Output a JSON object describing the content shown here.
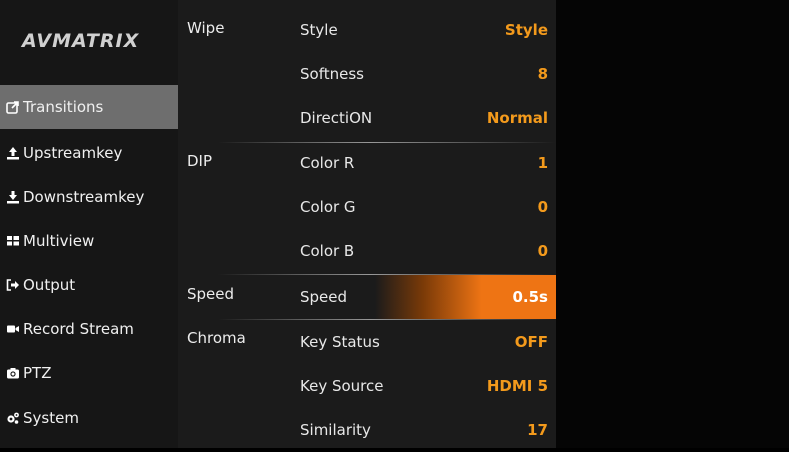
{
  "brand": {
    "logo_text": "AVMATRIX"
  },
  "sidebar": {
    "items": [
      {
        "label": "Transitions",
        "icon": "share-icon",
        "active": true
      },
      {
        "label": "Upstreamkey",
        "icon": "upload-icon",
        "active": false
      },
      {
        "label": "Downstreamkey",
        "icon": "download-icon",
        "active": false
      },
      {
        "label": "Multiview",
        "icon": "grid-icon",
        "active": false
      },
      {
        "label": "Output",
        "icon": "sign-out-icon",
        "active": false
      },
      {
        "label": "Record Stream",
        "icon": "video-camera-icon",
        "active": false
      },
      {
        "label": "PTZ",
        "icon": "camera-icon",
        "active": false
      },
      {
        "label": "System",
        "icon": "gears-icon",
        "active": false
      }
    ]
  },
  "groups": {
    "wipe": "Wipe",
    "dip": "DIP",
    "speed": "Speed",
    "chroma": "Chroma"
  },
  "settings": {
    "rows": [
      {
        "label": "Style",
        "value": "Style"
      },
      {
        "label": "Softness",
        "value": "8"
      },
      {
        "label": "DirectiON",
        "value": "Normal"
      },
      {
        "label": "Color R",
        "value": "1"
      },
      {
        "label": "Color G",
        "value": "0"
      },
      {
        "label": "Color B",
        "value": "0"
      },
      {
        "label": "Speed",
        "value": "0.5s",
        "selected": true
      },
      {
        "label": "Key Status",
        "value": "OFF"
      },
      {
        "label": "Key Source",
        "value": "HDMI 5"
      },
      {
        "label": "Similarity",
        "value": "17"
      }
    ]
  },
  "colors": {
    "accent": "#ee7414",
    "value_text": "#f39a1c",
    "sidebar_active": "#6e6e6e",
    "sidebar_bg": "#161616",
    "panel_bg": "#1b1b1b"
  }
}
